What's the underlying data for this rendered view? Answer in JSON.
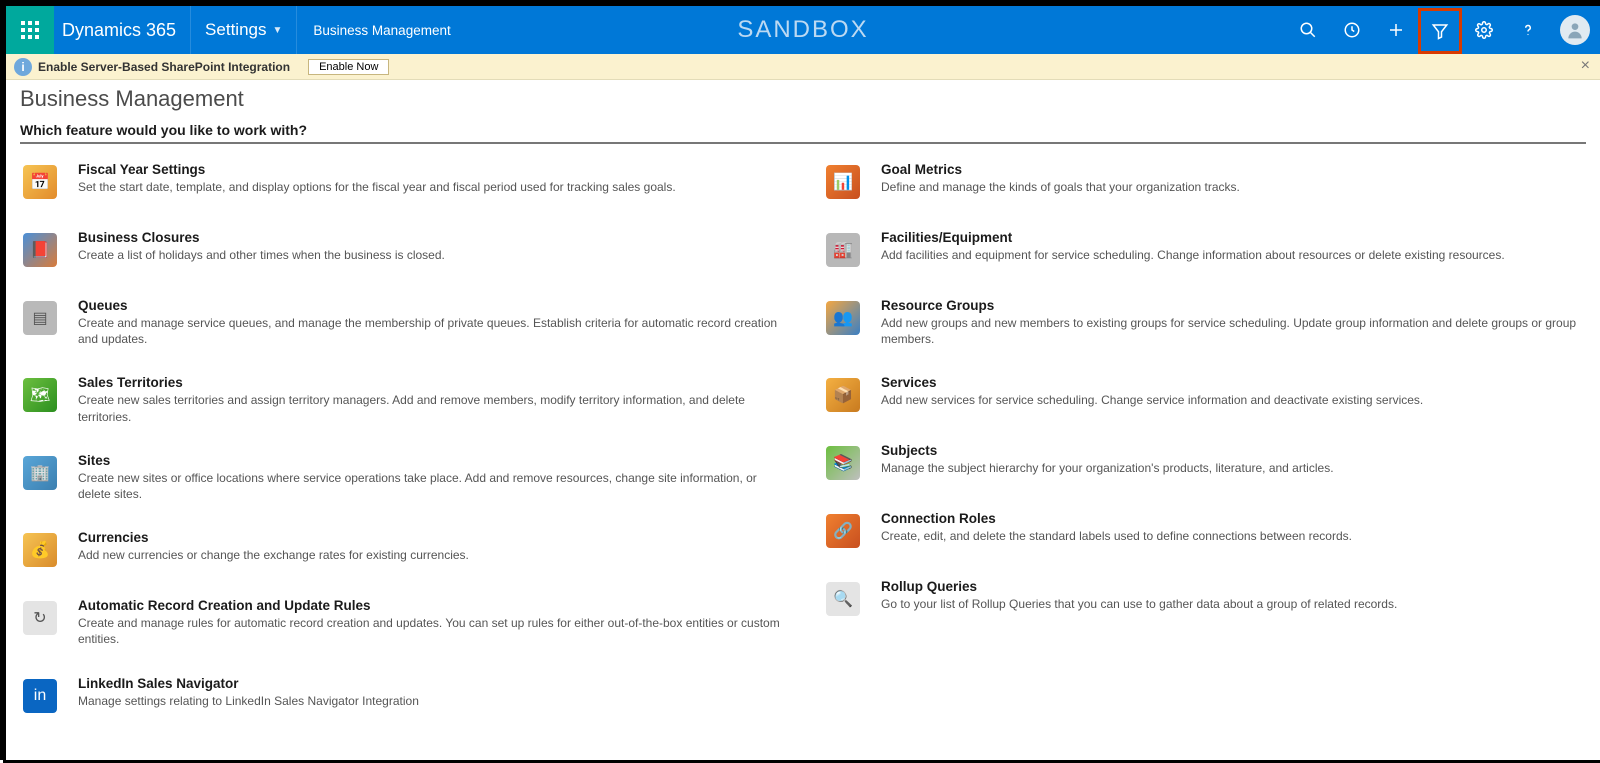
{
  "nav": {
    "product": "Dynamics 365",
    "area": "Settings",
    "breadcrumb": "Business Management",
    "environment": "SANDBOX"
  },
  "notification": {
    "text": "Enable Server-Based SharePoint Integration",
    "button": "Enable Now"
  },
  "page": {
    "title": "Business Management",
    "prompt": "Which feature would you like to work with?"
  },
  "left": [
    {
      "title": "Fiscal Year Settings",
      "desc": "Set the start date, template, and display options for the fiscal year and fiscal period used for tracking sales goals."
    },
    {
      "title": "Business Closures",
      "desc": "Create a list of holidays and other times when the business is closed."
    },
    {
      "title": "Queues",
      "desc": "Create and manage service queues, and manage the membership of private queues. Establish criteria for automatic record creation and updates."
    },
    {
      "title": "Sales Territories",
      "desc": "Create new sales territories and assign territory managers. Add and remove members, modify territory information, and delete territories."
    },
    {
      "title": "Sites",
      "desc": "Create new sites or office locations where service operations take place. Add and remove resources, change site information, or delete sites."
    },
    {
      "title": "Currencies",
      "desc": "Add new currencies or change the exchange rates for existing currencies."
    },
    {
      "title": "Automatic Record Creation and Update Rules",
      "desc": "Create and manage rules for automatic record creation and updates. You can set up rules for either out-of-the-box entities or custom entities."
    },
    {
      "title": "LinkedIn Sales Navigator",
      "desc": "Manage settings relating to LinkedIn Sales Navigator Integration"
    }
  ],
  "right": [
    {
      "title": "Goal Metrics",
      "desc": "Define and manage the kinds of goals that your organization tracks."
    },
    {
      "title": "Facilities/Equipment",
      "desc": "Add facilities and equipment for service scheduling. Change information about resources or delete existing resources."
    },
    {
      "title": "Resource Groups",
      "desc": "Add new groups and new members to existing groups for service scheduling. Update group information and delete groups or group members."
    },
    {
      "title": "Services",
      "desc": "Add new services for service scheduling. Change service information and deactivate existing services."
    },
    {
      "title": "Subjects",
      "desc": "Manage the subject hierarchy for your organization's products, literature, and articles."
    },
    {
      "title": "Connection Roles",
      "desc": "Create, edit, and delete the standard labels used to define connections between records."
    },
    {
      "title": "Rollup Queries",
      "desc": "Go to your list of Rollup Queries that you can use to gather data about a group of related records."
    }
  ],
  "icons": {
    "left": [
      "c1",
      "c2",
      "c3",
      "c4",
      "c5",
      "c6",
      "c7",
      "c8"
    ],
    "right": [
      "c9",
      "c10",
      "c11",
      "c12",
      "c13",
      "c14",
      "c15"
    ],
    "glyph_left": [
      "📅",
      "📕",
      "▤",
      "🗺",
      "🏢",
      "💰",
      "↻",
      "in"
    ],
    "glyph_right": [
      "📊",
      "🏭",
      "👥",
      "📦",
      "📚",
      "🔗",
      "🔍"
    ]
  }
}
